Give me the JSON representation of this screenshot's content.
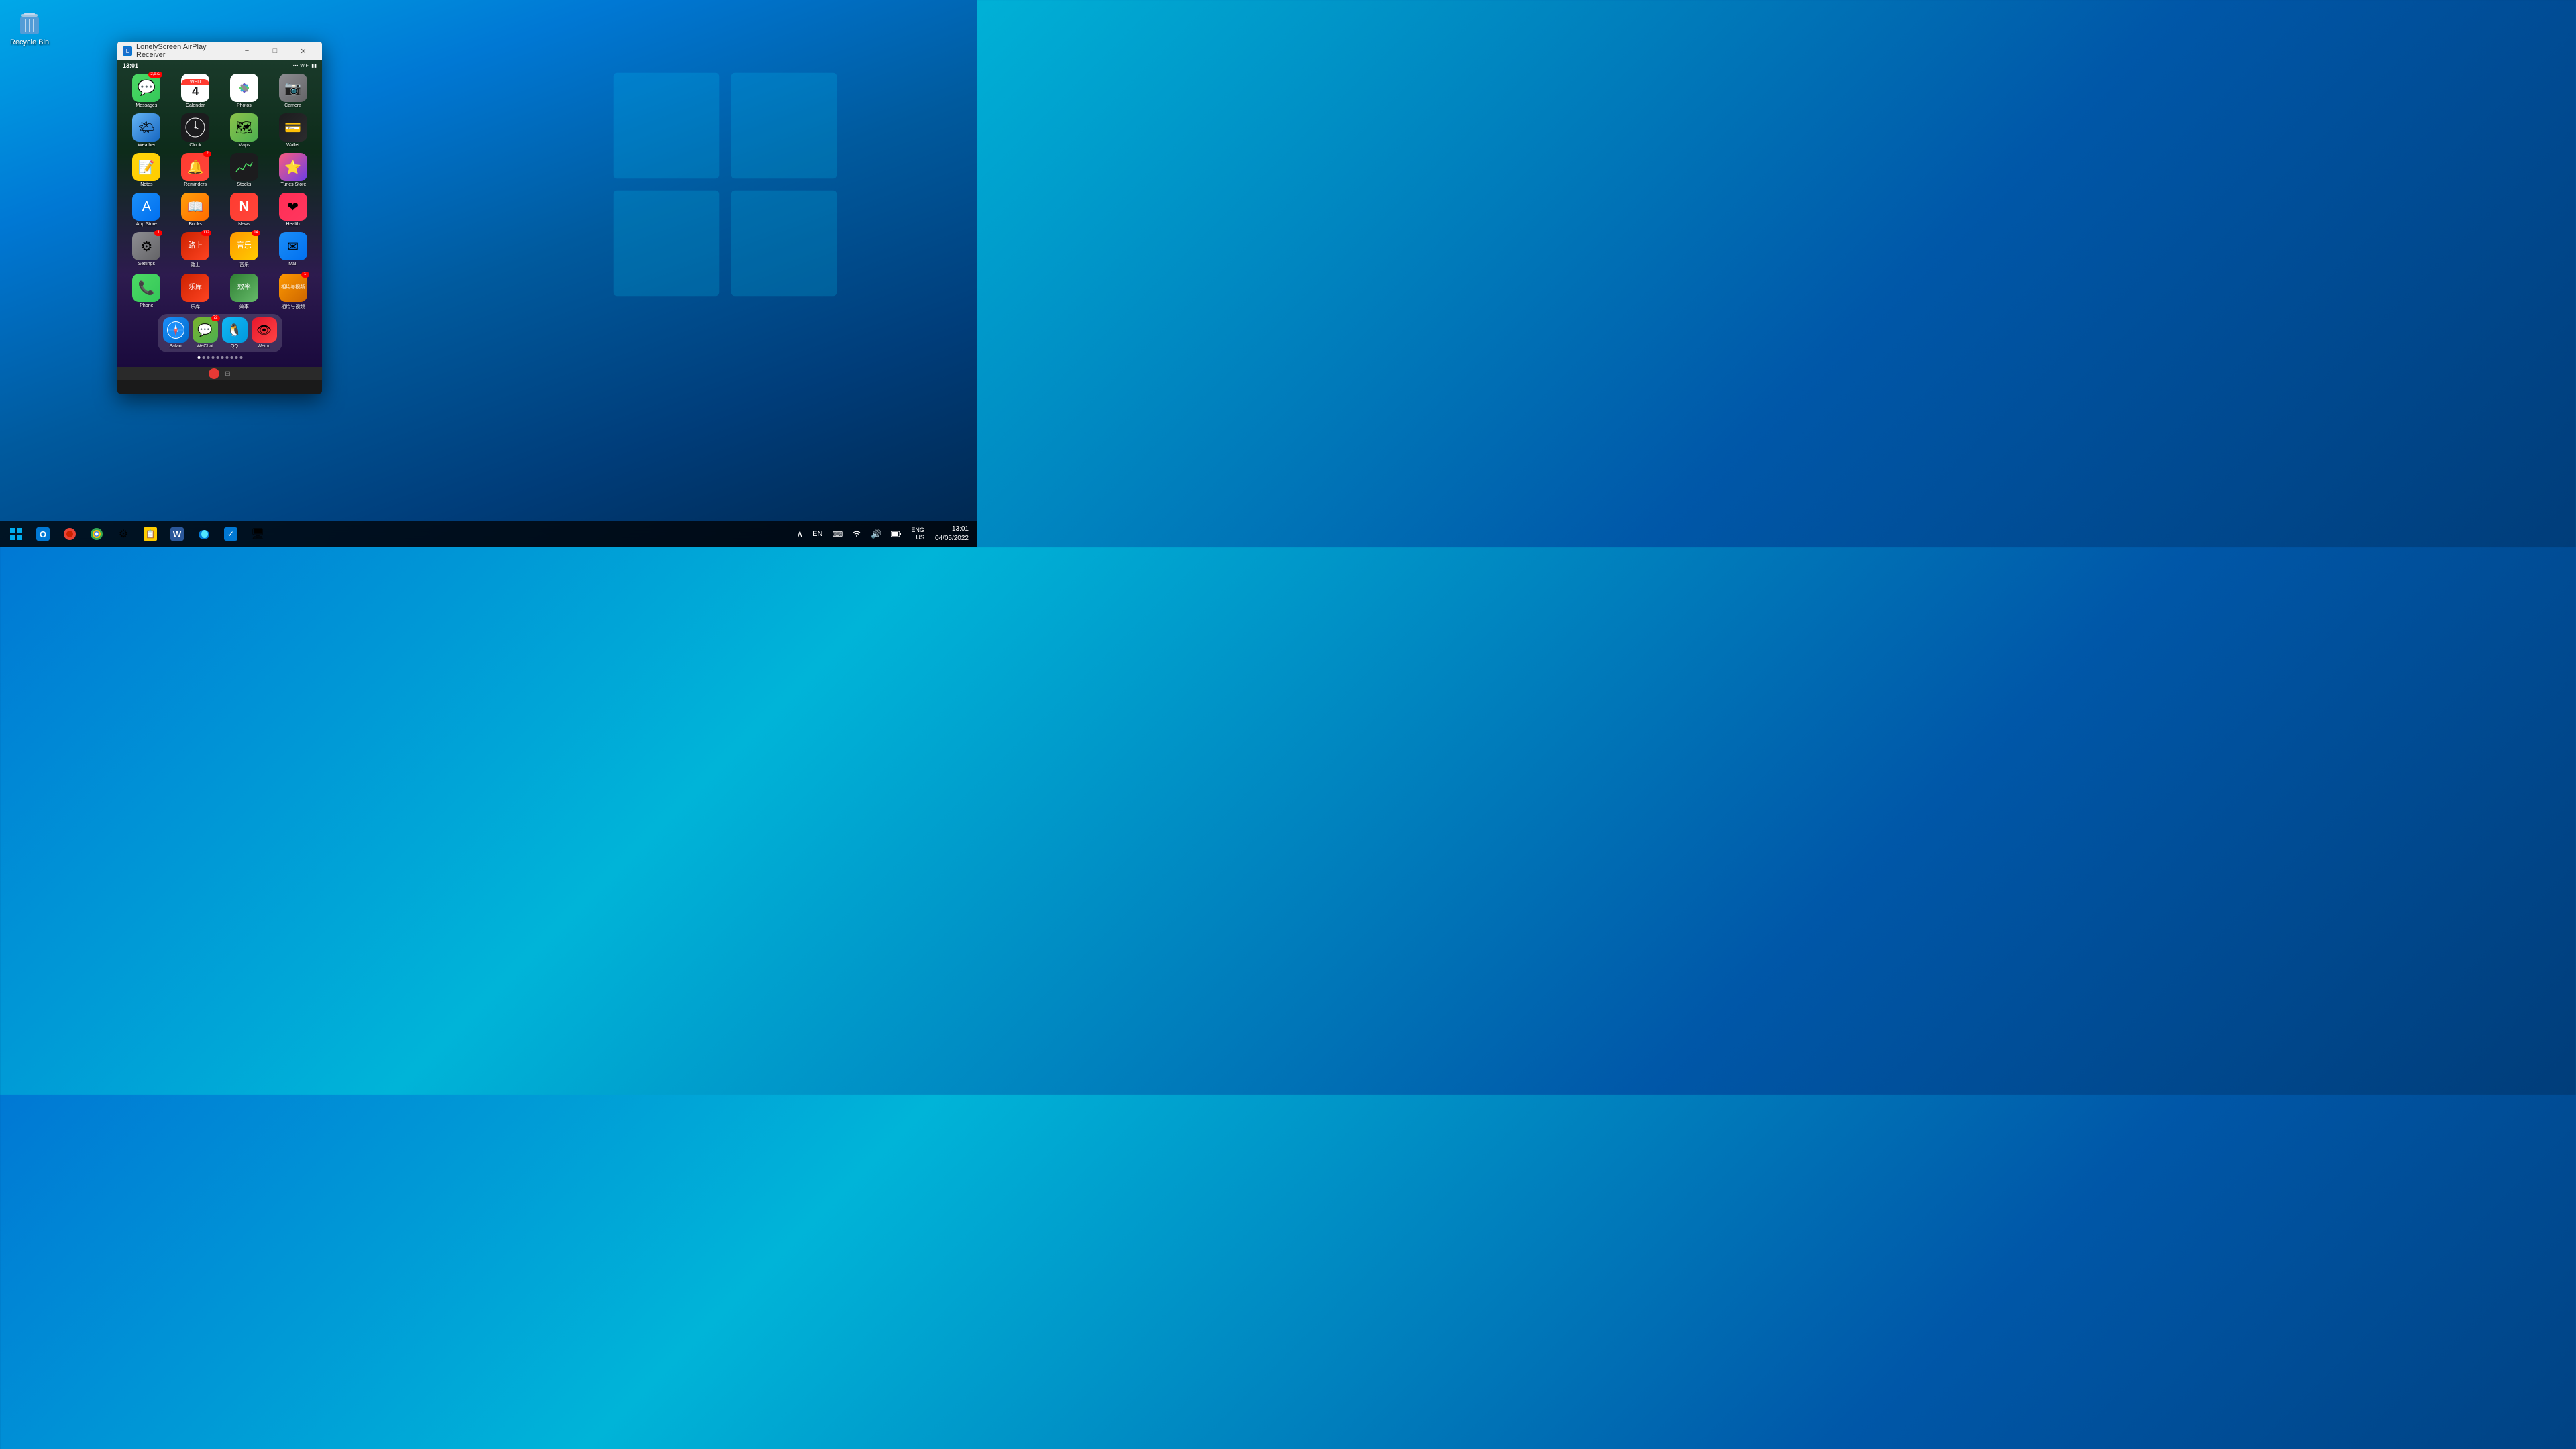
{
  "desktop": {
    "recycle_bin": {
      "label": "Recycle Bin",
      "icon": "🗑️"
    }
  },
  "windows_logo": {
    "visible": true
  },
  "airplay_window": {
    "title": "LonelyScreen AirPlay Receiver",
    "controls": {
      "minimize": "−",
      "maximize": "□",
      "close": "✕"
    }
  },
  "phone": {
    "status_bar": {
      "time": "13:01",
      "wifi": "WiFi",
      "battery": "Battery"
    },
    "apps_row1": [
      {
        "name": "Messages",
        "label": "Messages",
        "badge": "2,972",
        "class": "app-messages",
        "icon": "💬"
      },
      {
        "name": "Calendar",
        "label": "Calendar",
        "badge": "",
        "class": "app-calendar",
        "icon": "📅"
      },
      {
        "name": "Photos",
        "label": "Photos",
        "badge": "",
        "class": "app-photos",
        "icon": "🌸"
      },
      {
        "name": "Camera",
        "label": "Camera",
        "badge": "",
        "class": "app-camera",
        "icon": "📷"
      }
    ],
    "apps_row2": [
      {
        "name": "Weather",
        "label": "Weather",
        "badge": "",
        "class": "app-weather",
        "icon": "🌤"
      },
      {
        "name": "Clock",
        "label": "Clock",
        "badge": "",
        "class": "app-clock",
        "icon": "🕐"
      },
      {
        "name": "Maps",
        "label": "Maps",
        "badge": "",
        "class": "app-maps",
        "icon": "🗺"
      },
      {
        "name": "Wallet",
        "label": "Wallet",
        "badge": "",
        "class": "app-wallet",
        "icon": "💳"
      }
    ],
    "apps_row3": [
      {
        "name": "Notes",
        "label": "Notes",
        "badge": "",
        "class": "app-notes",
        "icon": "📝"
      },
      {
        "name": "Reminders",
        "label": "Reminders",
        "badge": "2",
        "class": "app-reminders",
        "icon": "🔔"
      },
      {
        "name": "Stocks",
        "label": "Stocks",
        "badge": "",
        "class": "app-stocks",
        "icon": "📈"
      },
      {
        "name": "iTunes Store",
        "label": "iTunes Store",
        "badge": "",
        "class": "app-itunes",
        "icon": "⭐"
      }
    ],
    "apps_row4": [
      {
        "name": "App Store",
        "label": "App Store",
        "badge": "",
        "class": "app-appstore",
        "icon": "🅐"
      },
      {
        "name": "Books",
        "label": "Books",
        "badge": "",
        "class": "app-books",
        "icon": "📖"
      },
      {
        "name": "News",
        "label": "News",
        "badge": "",
        "class": "app-news",
        "icon": "📰"
      },
      {
        "name": "Health",
        "label": "Health",
        "badge": "",
        "class": "app-health",
        "icon": "❤"
      }
    ],
    "apps_row5": [
      {
        "name": "Settings",
        "label": "Settings",
        "badge": "1",
        "class": "app-settings",
        "icon": "⚙"
      },
      {
        "name": "Chinese1",
        "label": "路上",
        "badge": "112",
        "class": "app-chinese1",
        "icon": ""
      },
      {
        "name": "Chinese2",
        "label": "音乐",
        "badge": "14",
        "class": "app-chinese2",
        "icon": ""
      },
      {
        "name": "Mail",
        "label": "Mail",
        "badge": "",
        "class": "app-mail",
        "icon": "✉"
      }
    ],
    "apps_row6": [
      {
        "name": "Phone",
        "label": "Phone",
        "badge": "",
        "class": "app-phone",
        "icon": "📞"
      },
      {
        "name": "Chinese3",
        "label": "乐库",
        "badge": "",
        "class": "app-chinese1",
        "icon": ""
      },
      {
        "name": "Chinese4",
        "label": "效率",
        "badge": "",
        "class": "app-chinese3",
        "icon": ""
      },
      {
        "name": "Chinese5",
        "label": "相片与视频",
        "badge": "1",
        "class": "app-chinese2",
        "icon": ""
      }
    ],
    "dock": [
      {
        "name": "Safari",
        "label": "Safari",
        "class": "app-safari",
        "icon": "🧭"
      },
      {
        "name": "WeChat",
        "label": "WeChat",
        "badge": "72",
        "class": "app-wechat",
        "icon": "💬"
      },
      {
        "name": "QQ",
        "label": "QQ",
        "class": "app-qq",
        "icon": "🐧"
      },
      {
        "name": "Weibo",
        "label": "Weibo",
        "class": "app-weibo",
        "icon": "👁"
      }
    ]
  },
  "taskbar": {
    "start_icon": "⊞",
    "time": "13:01",
    "date": "04/05/2022",
    "language": "ENG\nUS",
    "apps": [
      {
        "name": "outlook",
        "icon": "📧",
        "color": "#0078d4"
      },
      {
        "name": "chrome-app",
        "icon": "🔴",
        "color": "#ea4335"
      },
      {
        "name": "chrome",
        "icon": "🌐",
        "color": "#34a853"
      },
      {
        "name": "settings-app",
        "icon": "⚙",
        "color": "#0078d4"
      },
      {
        "name": "sticky-notes",
        "icon": "📋",
        "color": "#ffcc00"
      },
      {
        "name": "word",
        "icon": "W",
        "color": "#2b579a"
      },
      {
        "name": "edge",
        "icon": "e",
        "color": "#0078d4"
      },
      {
        "name": "todo",
        "icon": "✓",
        "color": "#0078d4"
      },
      {
        "name": "remote-desktop",
        "icon": "🖥",
        "color": "#0078d4"
      }
    ],
    "system_tray": {
      "show_hidden": "^",
      "language": "ENG US",
      "input_icon": "⌨",
      "wifi": "WiFi",
      "volume": "🔊",
      "battery": "🔋"
    }
  }
}
